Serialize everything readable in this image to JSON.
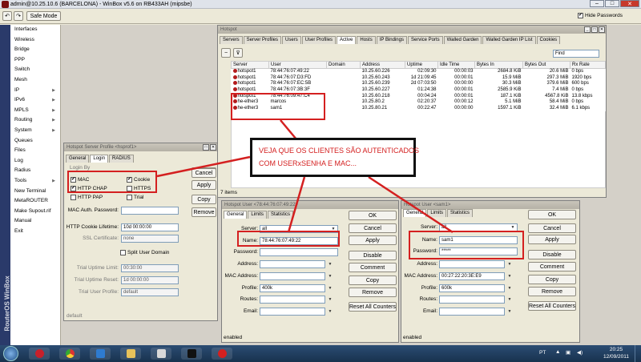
{
  "app": {
    "title": "admin@10.25.10.6 (BARCELONA) - WinBox v5.6 on RB433AH (mipsbe)"
  },
  "toolbar": {
    "safe_mode": "Safe Mode",
    "hide_passwords": "Hide Passwords"
  },
  "sidebar": {
    "vertical_label": "RouterOS WinBox",
    "items": [
      {
        "label": "Interfaces"
      },
      {
        "label": "Wireless"
      },
      {
        "label": "Bridge"
      },
      {
        "label": "PPP"
      },
      {
        "label": "Switch"
      },
      {
        "label": "Mesh"
      },
      {
        "label": "IP"
      },
      {
        "label": "IPv6"
      },
      {
        "label": "MPLS"
      },
      {
        "label": "Routing"
      },
      {
        "label": "System"
      },
      {
        "label": "Queues"
      },
      {
        "label": "Files"
      },
      {
        "label": "Log"
      },
      {
        "label": "Radius"
      },
      {
        "label": "Tools"
      },
      {
        "label": "New Terminal"
      },
      {
        "label": "MetaROUTER"
      },
      {
        "label": "Make Supout.rif"
      },
      {
        "label": "Manual"
      },
      {
        "label": "Exit"
      }
    ]
  },
  "hotspot": {
    "title": "Hotspot",
    "tabs": [
      "Servers",
      "Server Profiles",
      "Users",
      "User Profiles",
      "Active",
      "Hosts",
      "IP Bindings",
      "Service Ports",
      "Walled Garden",
      "Walled Garden IP List",
      "Cookies"
    ],
    "find": "Find",
    "columns": [
      "Server",
      "User",
      "Domain",
      "Address",
      "Uptime",
      "Idle Time",
      "Bytes In",
      "Bytes Out",
      "Rx Rate"
    ],
    "rows": [
      [
        "hotspot1",
        "78:44:76:07:49:22",
        "",
        "10.25.60.226",
        "02:09:30",
        "00:00:03",
        "2684.8 KiB",
        "20.6 MiB",
        "0 bps"
      ],
      [
        "hotspot1",
        "78:44:76:07:D3:FD",
        "",
        "10.25.60.243",
        "1d 21:09:45",
        "00:00:01",
        "15.9 MiB",
        "297.3 MiB",
        "1920 bps"
      ],
      [
        "hotspot1",
        "78:44:76:07:EC:5B",
        "",
        "10.25.60.239",
        "2d 07:03:50",
        "00:00:00",
        "30.3 MiB",
        "379.6 MiB",
        "600 bps"
      ],
      [
        "hotspot1",
        "78:44:76:07:3B:3F",
        "",
        "10.25.60.227",
        "01:24:38",
        "00:00:01",
        "2585.9 KiB",
        "7.4 MiB",
        "0 bps"
      ],
      [
        "hotspot1",
        "78:44:76:09:47:C4",
        "",
        "10.25.60.218",
        "00:04:24",
        "00:00:01",
        "187.1 KiB",
        "4567.8 KiB",
        "13.8 kbps"
      ],
      [
        "he-ether3",
        "marcos",
        "",
        "10.25.80.2",
        "02:20:37",
        "00:00:12",
        "5.1 MiB",
        "58.4 MiB",
        "0 bps"
      ],
      [
        "he-ether3",
        "sam1",
        "",
        "10.25.80.21",
        "00:22:47",
        "00:00:00",
        "1597.1 KiB",
        "32.4 MiB",
        "6.1 kbps"
      ]
    ],
    "status": "7 items"
  },
  "server_profile": {
    "title": "Hotspot Server Profile <hsprof1>",
    "tabs": [
      "General",
      "Login",
      "RADIUS"
    ],
    "login_by_label": "Login By",
    "checkboxes": [
      {
        "label": "MAC",
        "checked": "✔"
      },
      {
        "label": "Cookie",
        "checked": "✔"
      },
      {
        "label": "HTTP CHAP",
        "checked": "✔"
      },
      {
        "label": "HTTPS",
        "checked": ""
      },
      {
        "label": "HTTP PAP",
        "checked": ""
      },
      {
        "label": "Trial",
        "checked": ""
      }
    ],
    "mac_auth_label": "MAC Auth. Password:",
    "cookie_label": "HTTP Cookie Lifetime:",
    "cookie_value": "10d 00:00:00",
    "ssl_label": "SSL Certificate:",
    "ssl_value": "none",
    "split_label": "Split User Domain",
    "trial_limit_label": "Trial Uptime Limit:",
    "trial_limit_value": "00:30:00",
    "trial_reset_label": "Trial Uptime Reset:",
    "trial_reset_value": "1d 00:00:00",
    "trial_profile_label": "Trial User Profile:",
    "trial_profile_value": "default",
    "buttons": [
      "OK",
      "Cancel",
      "Apply",
      "Copy",
      "Remove"
    ],
    "status": "default"
  },
  "user1": {
    "title": "Hotspot User <78:44:76:07:49:22>",
    "tabs": [
      "General",
      "Limits",
      "Statistics"
    ],
    "server_label": "Server:",
    "server_value": "all",
    "name_label": "Name:",
    "name_value": "78:44:76:07:49:22",
    "password_label": "Password:",
    "password_value": "",
    "address_label": "Address:",
    "mac_label": "MAC Address:",
    "profile_label": "Profile:",
    "profile_value": "400k",
    "routes_label": "Routes:",
    "email_label": "Email:",
    "buttons": [
      "OK",
      "Cancel",
      "Apply",
      "Disable",
      "Comment",
      "Copy",
      "Remove",
      "Reset All Counters"
    ],
    "status": "enabled"
  },
  "user2": {
    "title": "Hotspot User <sam1>",
    "tabs": [
      "General",
      "Limits",
      "Statistics"
    ],
    "server_label": "Server:",
    "server_value": "all",
    "name_label": "Name:",
    "name_value": "sam1",
    "password_label": "Password:",
    "password_value": "*****",
    "address_label": "Address:",
    "mac_label": "MAC Address:",
    "mac_value": "00:27:22:20:3E:E9",
    "profile_label": "Profile:",
    "profile_value": "600k",
    "routes_label": "Routes:",
    "email_label": "Email:",
    "buttons": [
      "OK",
      "Cancel",
      "Apply",
      "Disable",
      "Comment",
      "Copy",
      "Remove",
      "Reset All Counters"
    ],
    "status": "enabled"
  },
  "callout": {
    "line1": "VEJA QUE OS CLIENTES SÃO AUTENTICADOS",
    "line2": "COM USERxSENHA E MAC..."
  },
  "taskbar": {
    "lang": "PT",
    "time": "20:25",
    "date": "12/09/2011"
  }
}
